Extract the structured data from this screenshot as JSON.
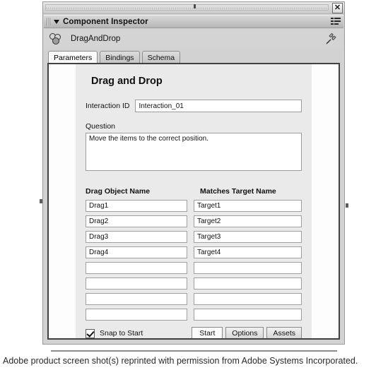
{
  "window": {
    "close_label": "✕",
    "panel_title": "Component Inspector",
    "collapse_icon": "triangle-down",
    "menu_icon": "panel-menu-icon"
  },
  "component": {
    "name": "DragAndDrop",
    "icon": "component-spheres-icon",
    "pin_icon": "pin-icon"
  },
  "tabs": [
    {
      "label": "Parameters",
      "active": true
    },
    {
      "label": "Bindings",
      "active": false
    },
    {
      "label": "Schema",
      "active": false
    }
  ],
  "form": {
    "title": "Drag and Drop",
    "interaction_id": {
      "label": "Interaction ID",
      "value": "Interaction_01",
      "placeholder": ""
    },
    "question": {
      "label": "Question",
      "value": "Move the items to the correct position.",
      "placeholder": ""
    },
    "columns": {
      "left_header": "Drag Object Name",
      "right_header": "Matches Target Name"
    },
    "rows": [
      {
        "drag": "Drag1",
        "target": "Target1"
      },
      {
        "drag": "Drag2",
        "target": "Target2"
      },
      {
        "drag": "Drag3",
        "target": "Target3"
      },
      {
        "drag": "Drag4",
        "target": "Target4"
      },
      {
        "drag": "",
        "target": ""
      },
      {
        "drag": "",
        "target": ""
      },
      {
        "drag": "",
        "target": ""
      },
      {
        "drag": "",
        "target": ""
      }
    ],
    "snap_to_start": {
      "label": "Snap to Start",
      "checked": true
    },
    "buttons": [
      {
        "label": "Start",
        "primary": true
      },
      {
        "label": "Options",
        "primary": false
      },
      {
        "label": "Assets",
        "primary": false
      }
    ]
  },
  "caption": {
    "text": "Adobe product screen shot(s) reprinted with permission from Adobe Systems Incorporated."
  },
  "colors": {
    "panel_bg": "#d2d2d2",
    "content_bg": "#eaeaea",
    "frame_border": "#414141",
    "field_bg": "#ffffff"
  }
}
